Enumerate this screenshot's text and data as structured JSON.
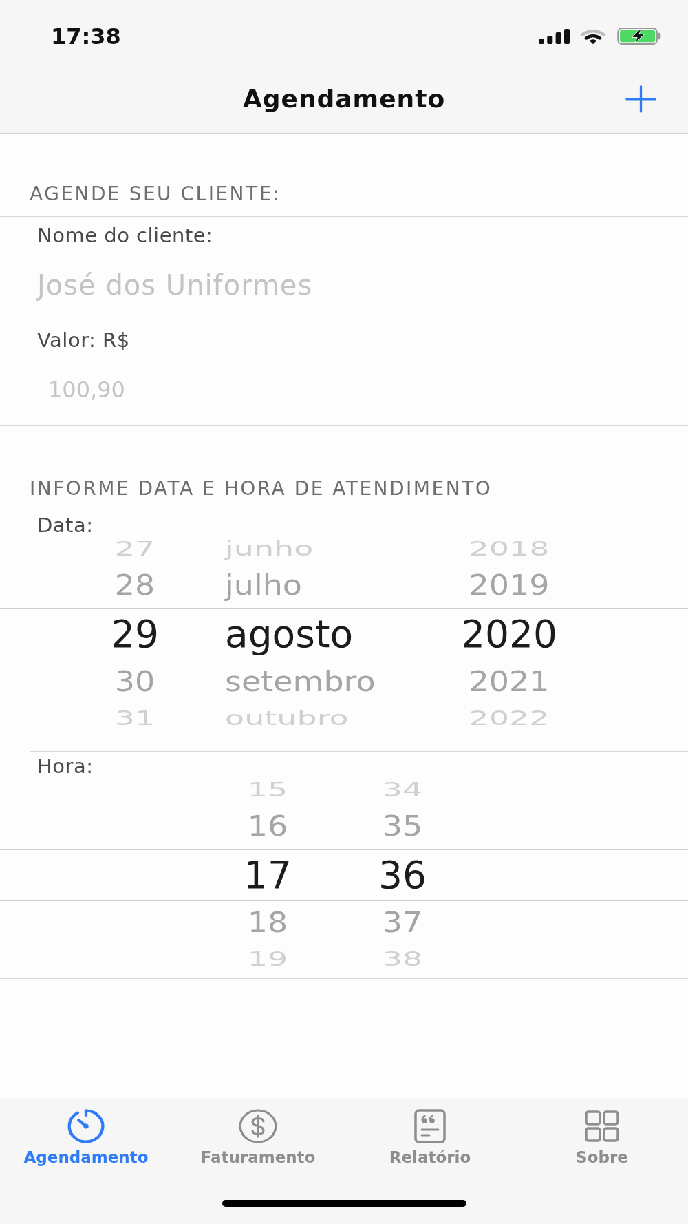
{
  "status_bar": {
    "time": "17:38"
  },
  "nav_bar": {
    "title": "Agendamento"
  },
  "client_section": {
    "header": "AGENDE SEU CLIENTE:",
    "fields": [
      {
        "kind": "text",
        "label": "Nome do cliente:",
        "placeholder": "José dos Uniformes"
      },
      {
        "kind": "number",
        "label": "Valor: R$",
        "placeholder": "100,90"
      }
    ]
  },
  "schedule_section": {
    "header": "INFORME DATA E HORA DE ATENDIMENTO",
    "pickers": [
      {
        "kind": "date",
        "label": "Data:",
        "columns": [
          {
            "items": [
              {
                "text": "27",
                "selected": false
              },
              {
                "text": "28",
                "selected": false
              },
              {
                "text": "29",
                "selected": true
              },
              {
                "text": "30",
                "selected": false
              },
              {
                "text": "31",
                "selected": false
              }
            ]
          },
          {
            "items": [
              {
                "text": "junho",
                "selected": false
              },
              {
                "text": "julho",
                "selected": false
              },
              {
                "text": "agosto",
                "selected": true
              },
              {
                "text": "setembro",
                "selected": false
              },
              {
                "text": "outubro",
                "selected": false
              }
            ]
          },
          {
            "items": [
              {
                "text": "2018",
                "selected": false
              },
              {
                "text": "2019",
                "selected": false
              },
              {
                "text": "2020",
                "selected": true
              },
              {
                "text": "2021",
                "selected": false
              },
              {
                "text": "2022",
                "selected": false
              }
            ]
          }
        ]
      },
      {
        "kind": "time",
        "label": "Hora:",
        "columns": [
          {
            "items": [
              {
                "text": "15",
                "selected": false
              },
              {
                "text": "16",
                "selected": false
              },
              {
                "text": "17",
                "selected": true
              },
              {
                "text": "18",
                "selected": false
              },
              {
                "text": "19",
                "selected": false
              }
            ]
          },
          {
            "items": [
              {
                "text": "34",
                "selected": false
              },
              {
                "text": "35",
                "selected": false
              },
              {
                "text": "36",
                "selected": true
              },
              {
                "text": "37",
                "selected": false
              },
              {
                "text": "38",
                "selected": false
              }
            ]
          }
        ]
      }
    ]
  },
  "tab_bar": {
    "tabs": [
      {
        "label": "Agendamento",
        "selected": true
      },
      {
        "label": "Faturamento",
        "selected": false
      },
      {
        "label": "Relatório",
        "selected": false
      },
      {
        "label": "Sobre",
        "selected": false
      }
    ]
  }
}
